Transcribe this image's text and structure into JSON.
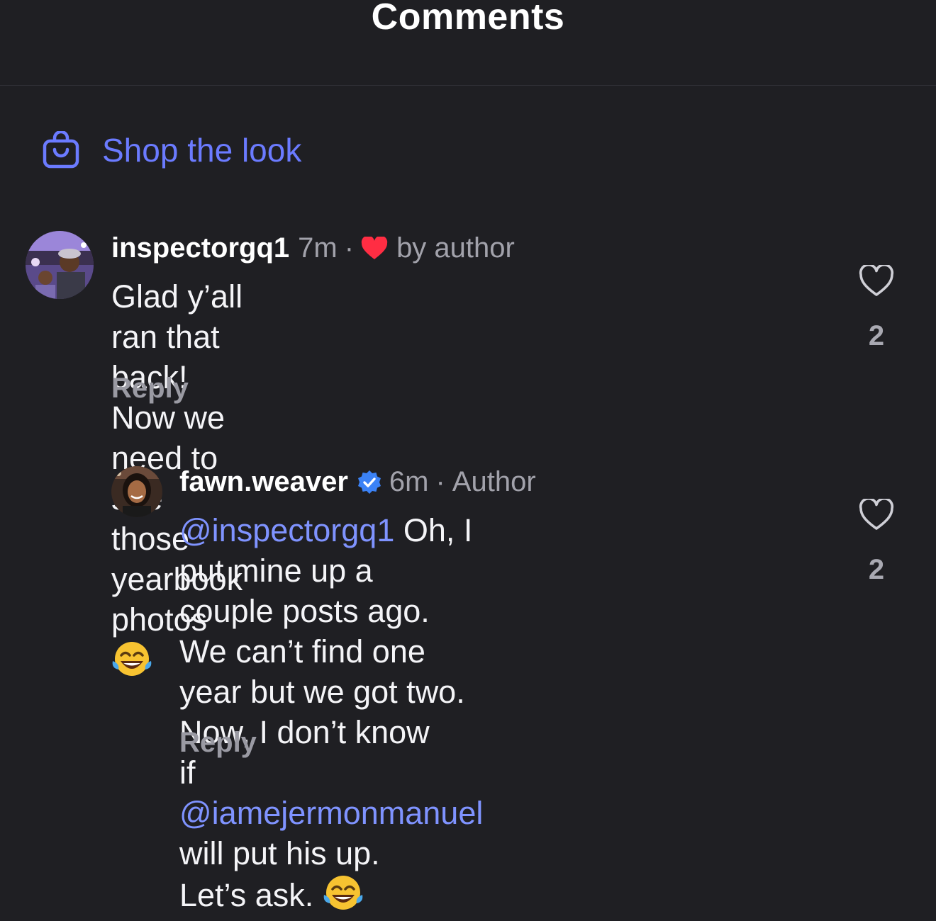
{
  "header": {
    "title": "Comments"
  },
  "shop": {
    "label": "Shop the look",
    "icon": "shopping-bag-icon",
    "accent": "#6b7bff"
  },
  "comments": [
    {
      "username": "inspectorgq1",
      "time": "7m",
      "separator": "·",
      "liked_by_author": "by author",
      "text_lines": [
        "Glad y’all ran that back! Now we need to",
        "see those yearbook photos"
      ],
      "emoji": "face-with-tears-of-joy",
      "reply_label": "Reply",
      "like_count": "2"
    },
    {
      "username": "fawn.weaver",
      "verified": true,
      "time": "6m",
      "separator": "·",
      "role": "Author",
      "mention_1": "@inspectorgq1",
      "text_1": " Oh, I put mine up a",
      "line_2": "couple posts ago. We can’t find one",
      "line_3": "year but we got two. Now, I don’t know",
      "line_4_prefix": "if ",
      "mention_2": "@iamejermonmanuel",
      "line_4_suffix": " will put his up.",
      "line_5": "Let’s ask.",
      "emoji": "face-with-tears-of-joy",
      "reply_label": "Reply",
      "like_count": "2"
    }
  ]
}
